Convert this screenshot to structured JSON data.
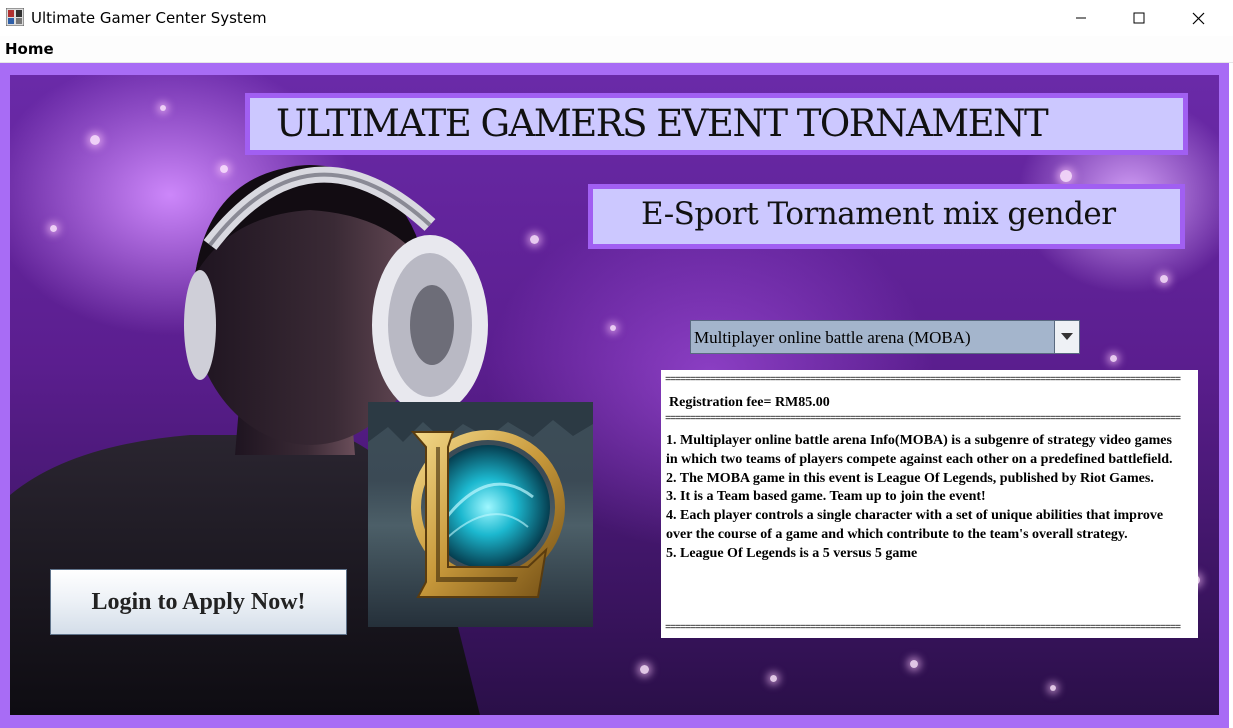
{
  "window": {
    "title": "Ultimate Gamer Center System",
    "controls": [
      "minimize",
      "maximize",
      "close"
    ]
  },
  "menu": {
    "items": [
      "Home"
    ]
  },
  "banner": {
    "title": "ULTIMATE GAMERS EVENT TORNAMENT",
    "subtitle": "E-Sport Tornament mix gender"
  },
  "game_select": {
    "selected": "Multiplayer online battle arena (MOBA)"
  },
  "info": {
    "separator": "=======================================================================================================",
    "fee": "Registration fee= RM85.00",
    "lines": [
      "1. Multiplayer online battle arena Info(MOBA) is a subgenre of strategy video games in which two teams of players compete against each other on a predefined battlefield.",
      "2. The MOBA game in this event is League Of Legends, published by Riot Games.",
      "3. It is a Team based game. Team up to join the event!",
      "4. Each player controls a single character with a set of unique abilities that improve over the course of a game and which contribute to the team's overall strategy.",
      "5. League Of Legends is a 5 versus 5 game"
    ]
  },
  "login": {
    "label": "Login to Apply Now!"
  },
  "colors": {
    "frame": "#a86cf5",
    "banner_bg": "#ccc8ff",
    "banner_border": "#a15ff2",
    "combo_bg": "#a4b5cc"
  },
  "icons": {
    "app": "app-icon",
    "logo": "league-of-legends-logo-icon",
    "combo": "chevron-down-icon"
  }
}
